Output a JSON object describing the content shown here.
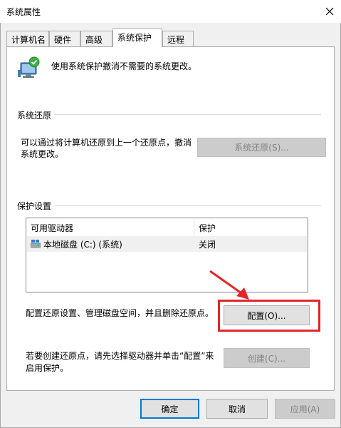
{
  "window": {
    "title": "系统属性"
  },
  "tabs": [
    {
      "label": "计算机名"
    },
    {
      "label": "硬件"
    },
    {
      "label": "高级"
    },
    {
      "label": "系统保护",
      "active": true
    },
    {
      "label": "远程"
    }
  ],
  "intro": {
    "text": "使用系统保护撤消不需要的系统更改。"
  },
  "system_restore": {
    "group_title": "系统还原",
    "description_line1": "可以通过将计算机还原到上一个还原点，撤消",
    "description_line2": "系统更改。",
    "button_label": "系统还原(S)..."
  },
  "protection_settings": {
    "group_title": "保护设置",
    "columns": [
      "可用驱动器",
      "保护"
    ],
    "rows": [
      {
        "drive": "本地磁盘 (C:) (系统)",
        "protection": "关闭"
      }
    ],
    "configure_text": "配置还原设置、管理磁盘空间，并且删除还原点。",
    "configure_button": "配置(O)...",
    "create_text_line1": "若要创建还原点，请先选择驱动器并单击“配置”来",
    "create_text_line2": "启用保护。",
    "create_button": "创建(C)..."
  },
  "footer": {
    "ok": "确定",
    "cancel": "取消",
    "apply": "应用(A)"
  },
  "colors": {
    "annotation": "#e3262a",
    "focus": "#0078d7"
  }
}
